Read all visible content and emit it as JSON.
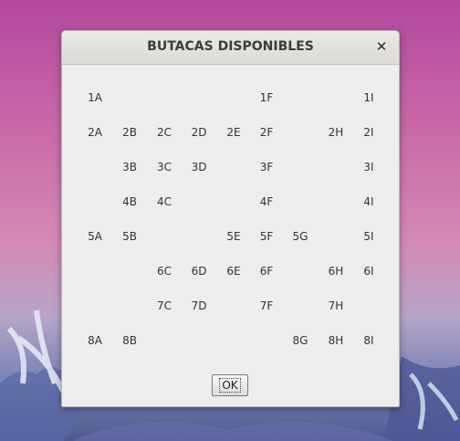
{
  "dialog": {
    "title": "BUTACAS DISPONIBLES",
    "close_symbol": "✕",
    "ok_label": "OK"
  },
  "seats": [
    [
      "1A",
      "",
      "",
      "",
      "",
      "1F",
      "",
      "",
      "1I"
    ],
    [
      "2A",
      "2B",
      "2C",
      "2D",
      "2E",
      "2F",
      "",
      "2H",
      "2I"
    ],
    [
      "",
      "3B",
      "3C",
      "3D",
      "",
      "3F",
      "",
      "",
      "3I"
    ],
    [
      "",
      "4B",
      "4C",
      "",
      "",
      "4F",
      "",
      "",
      "4I"
    ],
    [
      "5A",
      "5B",
      "",
      "",
      "5E",
      "5F",
      "5G",
      "",
      "5I"
    ],
    [
      "",
      "",
      "6C",
      "6D",
      "6E",
      "6F",
      "",
      "6H",
      "6I"
    ],
    [
      "",
      "",
      "7C",
      "7D",
      "",
      "7F",
      "",
      "7H",
      ""
    ],
    [
      "8A",
      "8B",
      "",
      "",
      "",
      "",
      "8G",
      "8H",
      "8I"
    ]
  ]
}
